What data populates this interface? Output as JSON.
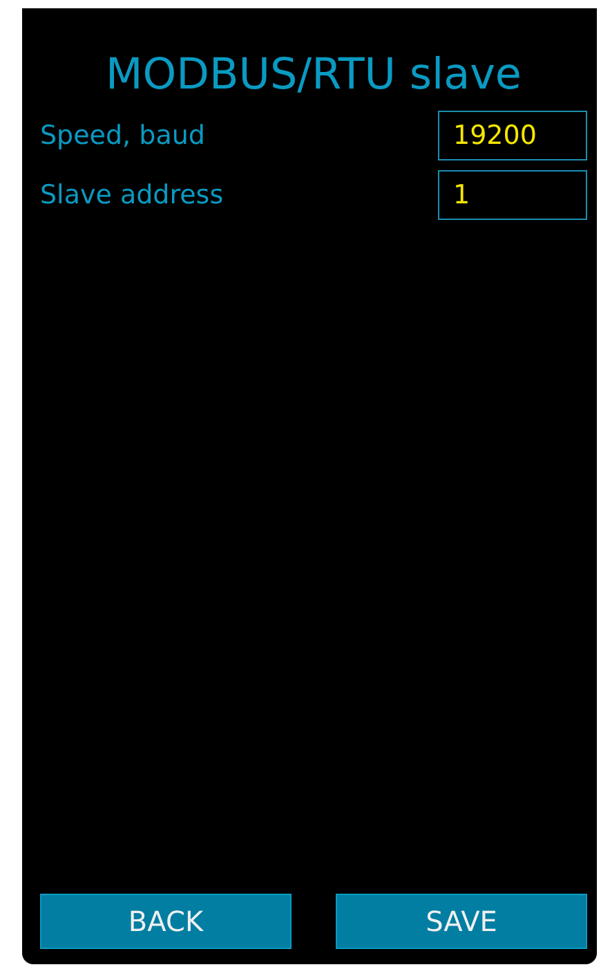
{
  "title": "MODBUS/RTU slave",
  "fields": [
    {
      "label": "Speed, baud",
      "value": "19200"
    },
    {
      "label": "Slave address",
      "value": "1"
    }
  ],
  "buttons": [
    "BACK",
    "SAVE"
  ]
}
